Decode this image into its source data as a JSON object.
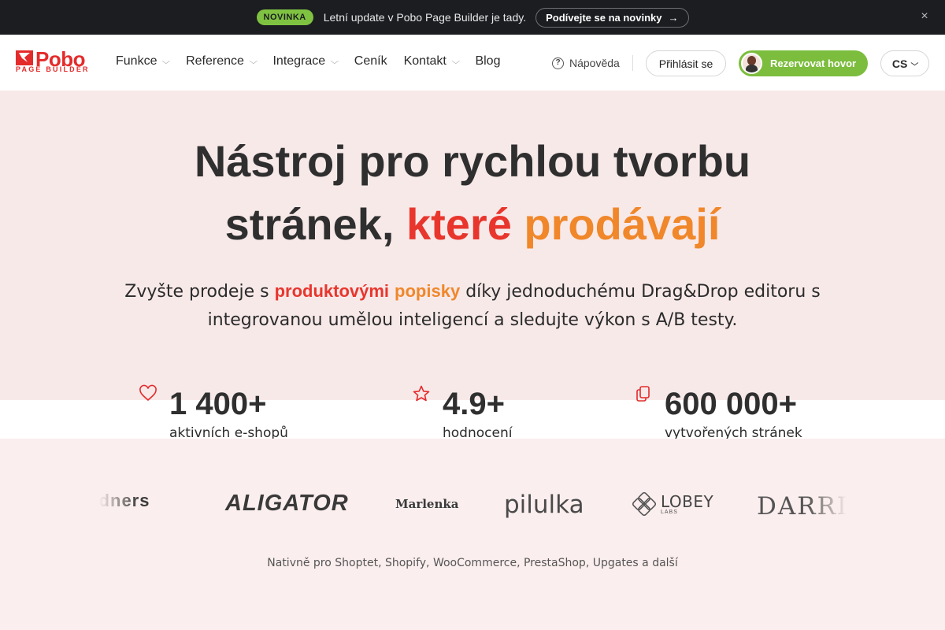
{
  "announcement": {
    "badge": "NOVINKA",
    "message": "Letní update v Pobo Page Builder je tady.",
    "cta": "Podívejte se na novinky",
    "cta_arrow": "→",
    "close": "×"
  },
  "logo": {
    "name": "Pobo",
    "sub": "PAGE BUILDER"
  },
  "nav": {
    "items": [
      {
        "label": "Funkce",
        "has_dropdown": true
      },
      {
        "label": "Reference",
        "has_dropdown": true
      },
      {
        "label": "Integrace",
        "has_dropdown": true
      },
      {
        "label": "Ceník",
        "has_dropdown": false
      },
      {
        "label": "Kontakt",
        "has_dropdown": true
      },
      {
        "label": "Blog",
        "has_dropdown": false
      }
    ],
    "chevron": "⌵"
  },
  "header": {
    "help": "Nápověda",
    "help_icon": "?",
    "login": "Přihlásit se",
    "book_call": "Rezervovat hovor",
    "language": "CS"
  },
  "hero": {
    "title_line1": "Nástroj pro rychlou tvorbu",
    "title_line2_plain": "stránek,",
    "title_highlight1": "které",
    "title_highlight2": "prodávají",
    "subtitle_before": "Zvyšte prodeje s",
    "subtitle_hl1": "produktovými",
    "subtitle_hl2": "popisky",
    "subtitle_after": "díky jednoduchému Drag&Drop editoru s integrovanou umělou inteligencí a sledujte výkon s A/B testy."
  },
  "stats": [
    {
      "icon": "heart-icon",
      "value": "1 400+",
      "label": "aktivních e-shopů"
    },
    {
      "icon": "star-icon",
      "value": "4.9+",
      "label": "hodnocení"
    },
    {
      "icon": "pages-icon",
      "value": "600 000+",
      "label": "vytvořených stránek"
    }
  ],
  "brands": [
    "rdners",
    "ALIGATOR",
    "Marlenka",
    "pilulka",
    "LOBEY",
    "LABS",
    "DARRI"
  ],
  "platforms": "Nativně pro Shoptet, Shopify, WooCommerce, PrestaShop, Upgates a další",
  "colors": {
    "brand_red": "#e42b2b",
    "accent_green": "#7cbd3d",
    "highlight_red": "#e8362d",
    "highlight_orange": "#f0872a",
    "dark_bar": "#1b1d21"
  }
}
